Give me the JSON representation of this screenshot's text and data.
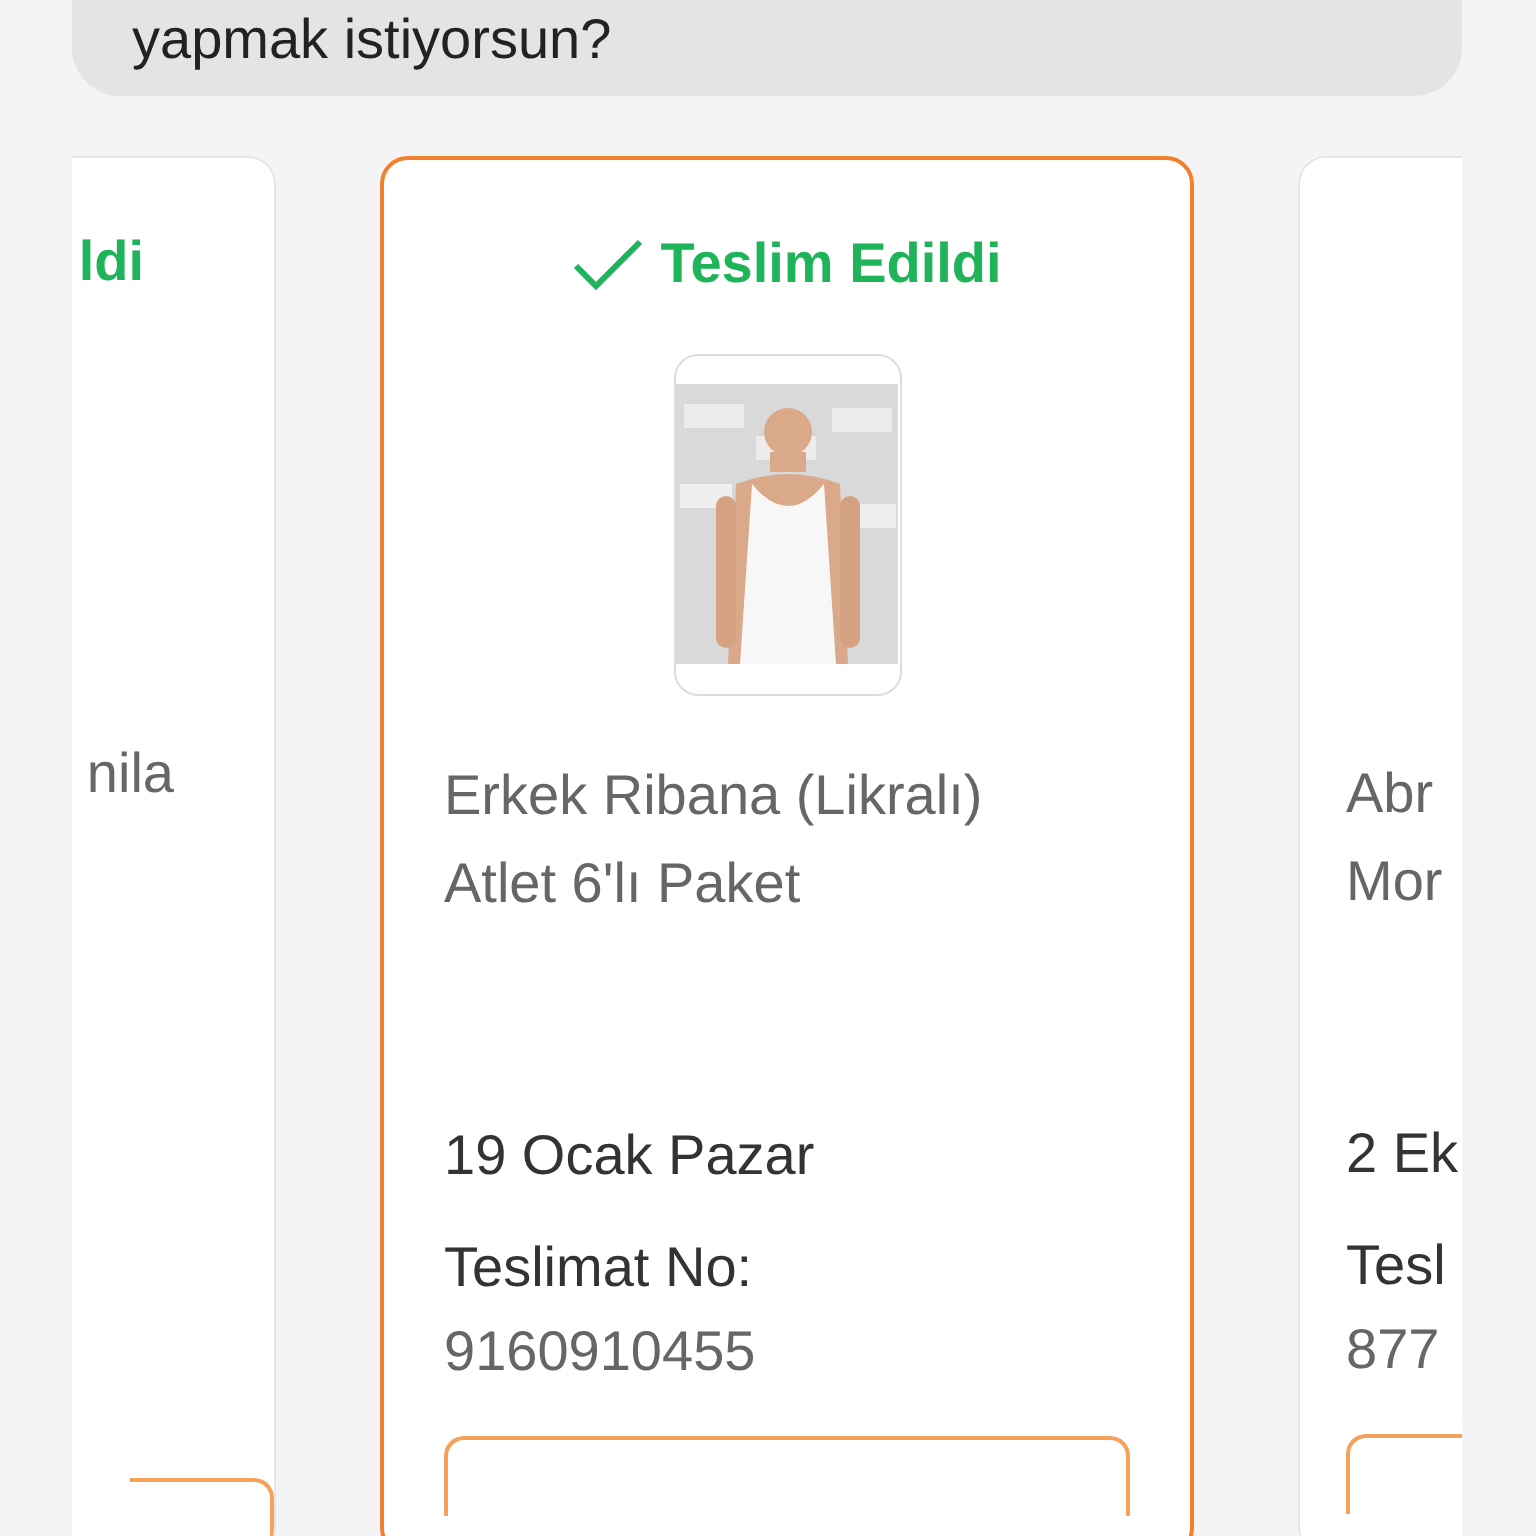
{
  "prompt_bubble": {
    "text": "yapmak istiyorsun?"
  },
  "orders": [
    {
      "kind": "clipped-left",
      "selected": false,
      "status": "ldi",
      "title_lines": [
        "nila"
      ]
    },
    {
      "kind": "full",
      "selected": true,
      "status": "Teslim Edildi",
      "image": {
        "kind": "picture"
      },
      "title_lines": [
        "Erkek Ribana (Likralı)",
        "Atlet 6'lı Paket"
      ],
      "date": "19 Ocak Pazar",
      "delivery_label": "Teslimat No:",
      "delivery_no": "9160910455"
    },
    {
      "kind": "clipped-right",
      "selected": false,
      "title_lines": [
        "Abr",
        "Mor"
      ],
      "date": "2 Ek",
      "delivery_label": "Tesl",
      "delivery_no": "877"
    }
  ]
}
